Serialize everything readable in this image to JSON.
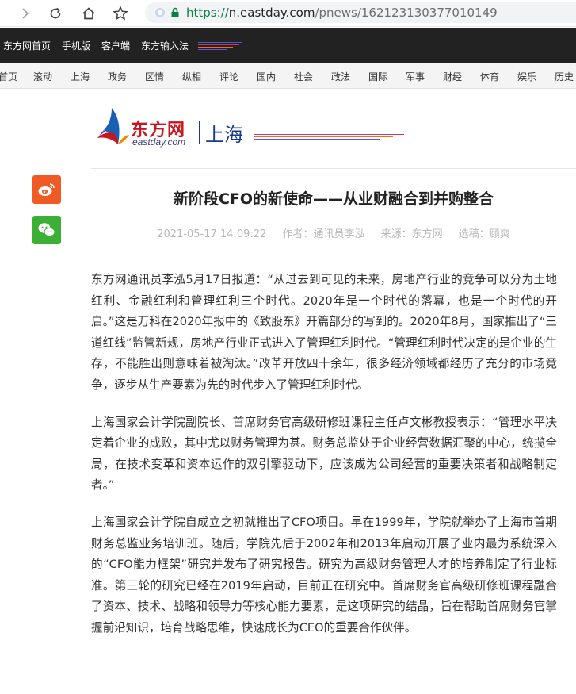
{
  "browser": {
    "url_scheme": "https://",
    "url_host": "n.eastday.com",
    "url_path": "/pnews/162123130377010149"
  },
  "top_nav": {
    "items": [
      "东方网首页",
      "手机版",
      "客户端",
      "东方输入法"
    ]
  },
  "channel_nav": {
    "items": [
      "首页",
      "滚动",
      "上海",
      "政务",
      "区情",
      "纵相",
      "评论",
      "国内",
      "社会",
      "政法",
      "国际",
      "军事",
      "财经",
      "体育",
      "娱乐",
      "历史"
    ]
  },
  "logo": {
    "name": "东方网",
    "domain": "eastday.com",
    "city": "上海"
  },
  "article": {
    "title": "新阶段CFO的新使命——从业财融合到并购整合",
    "meta": {
      "datetime": "2021-05-17 14:09:22",
      "author": "作者：通讯员李泓",
      "source": "来源：东方网",
      "editor": "选稿：顾爽"
    },
    "paragraphs": [
      "东方网通讯员李泓5月17日报道：“从过去到可见的未来，房地产行业的竞争可以分为土地红利、金融红利和管理红利三个时代。2020年是一个时代的落幕，也是一个时代的开启。”这是万科在2020年报中的《致股东》开篇部分的写到的。2020年8月，国家推出了“三道红线”监管新规，房地产行业正式进入了管理红利时代。“管理红利时代决定的是企业的生存，不能胜出则意味着被淘汰。”改革开放四十余年，很多经济领域都经历了充分的市场竞争，逐步从生产要素为先的时代步入了管理红利时代。",
      "上海国家会计学院副院长、首席财务官高级研修班课程主任卢文彬教授表示：“管理水平决定着企业的成败，其中尤以财务管理为甚。财务总监处于企业经营数据汇聚的中心，统揽全局，在技术变革和资本运作的双引擎驱动下，应该成为公司经营的重要决策者和战略制定者。”",
      "上海国家会计学院自成立之初就推出了CFO项目。早在1999年，学院就举办了上海市首期财务总监业务培训班。随后，学院先后于2002年和2013年启动开展了业内最为系统深入的“CFO能力框架”研究并发布了研究报告。研究为高级财务管理人才的培养制定了行业标准。第三轮的研究已经在2019年启动，目前正在研究中。首席财务官高级研修班课程融合了资本、技术、战略和领导力等核心能力要素，是这项研究的结晶，旨在帮助首席财务官掌握前沿知识，培育战略思维，快速成长为CEO的重要合作伙伴。"
    ]
  },
  "colors": {
    "top_bar_bg": "#222222",
    "weibo_orange": "#f05a24",
    "wechat_green": "#3cb034",
    "brand_red": "#c7161e",
    "brand_blue": "#1a3a8a",
    "secure_green": "#0b8043"
  }
}
